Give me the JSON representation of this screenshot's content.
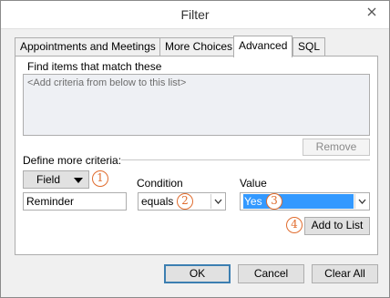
{
  "window": {
    "title": "Filter",
    "close_icon": "close-icon"
  },
  "tabs": [
    {
      "label": "Appointments and Meetings"
    },
    {
      "label": "More Choices"
    },
    {
      "label": "Advanced",
      "active": true
    },
    {
      "label": "SQL"
    }
  ],
  "advanced": {
    "find_label": "Find items that match these",
    "criteria_placeholder": "<Add criteria from below to this list>",
    "remove_label": "Remove",
    "define_label": "Define more criteria:",
    "field_label": "Field",
    "condition_label": "Condition",
    "value_label": "Value",
    "field_value": "Reminder",
    "condition_value": "equals",
    "value_value": "Yes",
    "add_label": "Add to List"
  },
  "badges": [
    "1",
    "2",
    "3",
    "4"
  ],
  "accent_color": "#e06c2e",
  "footer": {
    "ok_label": "OK",
    "cancel_label": "Cancel",
    "clear_label": "Clear All"
  }
}
